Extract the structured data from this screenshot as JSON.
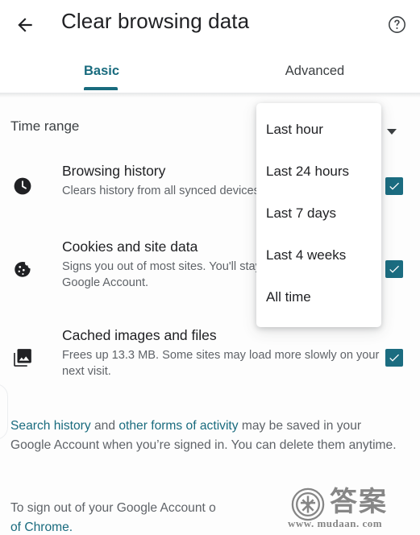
{
  "appbar": {
    "title": "Clear browsing data",
    "back_icon": "arrow-back-icon",
    "help_icon": "help-circle-icon"
  },
  "tabs": [
    {
      "label": "Basic",
      "selected": true
    },
    {
      "label": "Advanced",
      "selected": false
    }
  ],
  "time_range": {
    "label": "Time range",
    "caret_icon": "chevron-down-icon"
  },
  "options": [
    {
      "icon": "clock-icon",
      "title": "Browsing history",
      "description": "Clears history from all synced devices",
      "checked": true
    },
    {
      "icon": "cookie-icon",
      "title": "Cookies and site data",
      "description": "Signs you out of most sites. You'll stay signed out of your Google Account.",
      "checked": true
    },
    {
      "icon": "photo-library-icon",
      "title": "Cached images and files",
      "description": "Frees up 13.3 MB. Some sites may load more slowly on your next visit.",
      "checked": true
    }
  ],
  "footnotes": {
    "note1": {
      "link1": "Search history",
      "mid": " and ",
      "link2": "other forms of activity",
      "tail": " may be saved in your Google Account when you’re signed in. You can delete them anytime."
    },
    "note2": {
      "head": "To sign out of your Google Account o",
      "link": "of Chrome."
    }
  },
  "dropdown": {
    "open": true,
    "items": [
      {
        "label": "Last hour"
      },
      {
        "label": "Last 24 hours"
      },
      {
        "label": "Last 7 days"
      },
      {
        "label": "Last 4 weeks"
      },
      {
        "label": "All time"
      }
    ]
  },
  "watermark": {
    "text": "答案",
    "url": "www. mudaan. com",
    "badge_glyph": "术"
  },
  "colors": {
    "accent": "#196B7E",
    "checkbox": "#1B6C80",
    "title_text": "#202124",
    "secondary_text": "#5f6368",
    "background": "#fdfdfd"
  }
}
